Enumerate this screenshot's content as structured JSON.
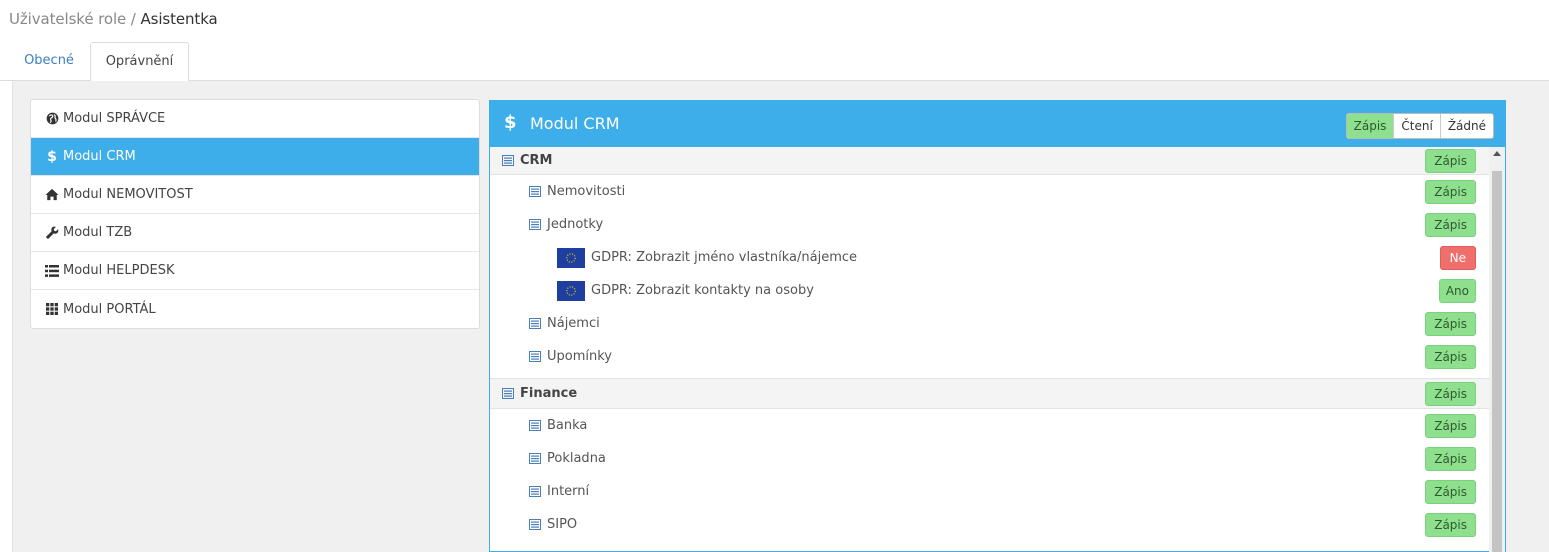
{
  "breadcrumb": {
    "parent": "Uživatelské role",
    "separator": " / ",
    "current": "Asistentka"
  },
  "tabs": [
    {
      "label": "Obecné",
      "active": false
    },
    {
      "label": "Oprávnění",
      "active": true
    }
  ],
  "modules": [
    {
      "label": "Modul SPRÁVCE",
      "icon": "globe-icon"
    },
    {
      "label": "Modul CRM",
      "icon": "dollar-icon",
      "active": true
    },
    {
      "label": "Modul NEMOVITOST",
      "icon": "home-icon"
    },
    {
      "label": "Modul TZB",
      "icon": "wrench-icon"
    },
    {
      "label": "Modul HELPDESK",
      "icon": "list-icon"
    },
    {
      "label": "Modul PORTÁL",
      "icon": "grid-icon"
    }
  ],
  "panel": {
    "icon_glyph": "$",
    "title": "Modul CRM",
    "buttons": [
      {
        "label": "Zápis",
        "active": true
      },
      {
        "label": "Čtení",
        "active": false
      },
      {
        "label": "Žádné",
        "active": false
      }
    ]
  },
  "rows": [
    {
      "label": "CRM",
      "level": "group",
      "value": "Zápis"
    },
    {
      "label": "Nemovitosti",
      "level": "lvl1",
      "value": "Zápis"
    },
    {
      "label": "Jednotky",
      "level": "lvl1",
      "value": "Zápis"
    },
    {
      "label": "GDPR: Zobrazit jméno vlastníka/nájemce",
      "level": "lvl2",
      "value": "Ne"
    },
    {
      "label": "GDPR: Zobrazit kontakty na osoby",
      "level": "lvl2",
      "value": "Ano"
    },
    {
      "label": "Nájemci",
      "level": "lvl1",
      "value": "Zápis"
    },
    {
      "label": "Upomínky",
      "level": "lvl1",
      "value": "Zápis"
    },
    {
      "label": "Finance",
      "level": "group",
      "value": "Zápis"
    },
    {
      "label": "Banka",
      "level": "lvl1",
      "value": "Zápis"
    },
    {
      "label": "Pokladna",
      "level": "lvl1",
      "value": "Zápis"
    },
    {
      "label": "Interní",
      "level": "lvl1",
      "value": "Zápis"
    },
    {
      "label": "SIPO",
      "level": "lvl1",
      "value": "Zápis"
    }
  ],
  "colors": {
    "accent": "#3daee9",
    "write": "#8ee08e",
    "deny": "#ef6f6c",
    "eu_flag": "#1f3fa0"
  }
}
